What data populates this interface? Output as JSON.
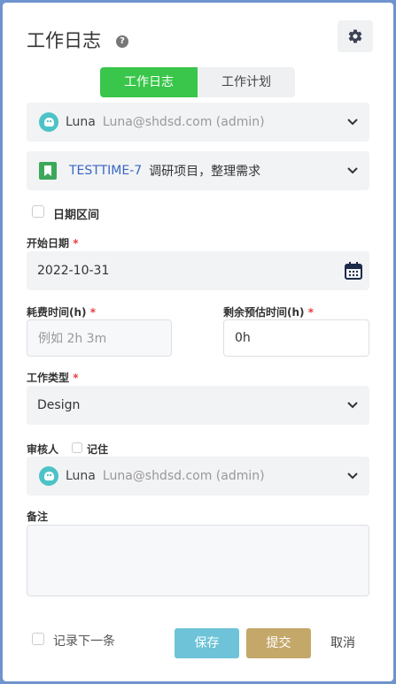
{
  "header": {
    "title": "工作日志",
    "help": "?"
  },
  "tabs": [
    {
      "label": "工作日志",
      "active": true
    },
    {
      "label": "工作计划",
      "active": false
    }
  ],
  "user_select": {
    "name": "Luna",
    "email": "Luna@shdsd.com (admin)"
  },
  "task_select": {
    "key": "TESTTIME-7",
    "title": "调研项目，整理需求"
  },
  "date_range": {
    "label": "日期区间",
    "checked": false
  },
  "start_date": {
    "label": "开始日期",
    "required": "*",
    "value": "2022-10-31"
  },
  "time_spent": {
    "label": "耗费时间(h)",
    "required": "*",
    "placeholder": "例如 2h 3m"
  },
  "remaining": {
    "label": "剩余预估时间(h)",
    "required": "*",
    "value": "0h"
  },
  "work_type": {
    "label": "工作类型",
    "required": "*",
    "value": "Design"
  },
  "reviewer": {
    "label": "审核人",
    "remember_label": "记住",
    "name": "Luna",
    "email": "Luna@shdsd.com (admin)"
  },
  "notes": {
    "label": "备注",
    "value": ""
  },
  "footer": {
    "record_next_label": "记录下一条",
    "save_label": "保存",
    "submit_label": "提交",
    "cancel_label": "取消"
  },
  "colors": {
    "accent": "#39c64a",
    "save": "#6ec3d8",
    "submit": "#c4a86a",
    "required": "#e53e3e",
    "link": "#3a66c4"
  }
}
